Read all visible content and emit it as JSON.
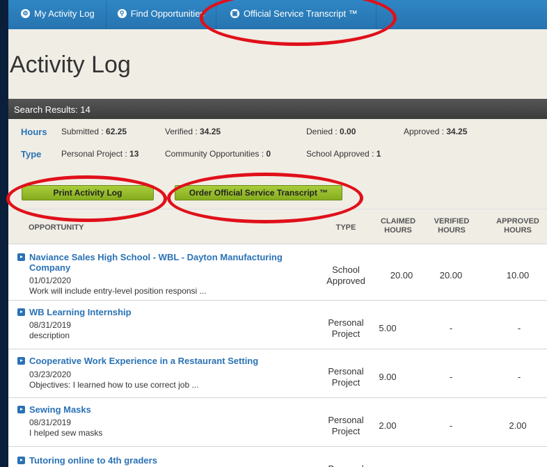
{
  "nav": {
    "items": [
      {
        "icon": "gear-icon",
        "label": "My Activity Log"
      },
      {
        "icon": "search-icon",
        "label": "Find Opportunities"
      },
      {
        "icon": "transcript-icon",
        "label": "Official Service Transcript ™"
      }
    ]
  },
  "page": {
    "title": "Activity Log"
  },
  "results": {
    "label": "Search Results: 14"
  },
  "hours": {
    "heading": "Hours",
    "submitted": "Submitted : ",
    "submitted_value": "62.25",
    "verified": "Verified : ",
    "verified_value": "34.25",
    "denied": "Denied : ",
    "denied_value": "0.00",
    "approved": "Approved : ",
    "approved_value": "34.25"
  },
  "type": {
    "heading": "Type",
    "personal": "Personal Project : ",
    "personal_value": "13",
    "community": "Community Opportunities : ",
    "community_value": "0",
    "school": "School Approved : ",
    "school_value": "1"
  },
  "buttons": {
    "print": "Print Activity Log",
    "order": "Order Official Service Transcript ™"
  },
  "table": {
    "headers": {
      "opportunity": "OPPORTUNITY",
      "type": "TYPE",
      "claimed": "CLAIMED HOURS",
      "verified": "VERIFIED HOURS",
      "approved": "APPROVED HOURS"
    },
    "rows": [
      {
        "name": "Naviance Sales High School  -  WBL - Dayton Manufacturing Company",
        "date": "01/01/2020",
        "desc": "Work will include entry-level position responsi ...",
        "type": "School Approved",
        "claimed": "20.00",
        "verified": "20.00",
        "approved": "10.00"
      },
      {
        "name": "WB Learning Internship",
        "date": "08/31/2019",
        "desc": "description",
        "type": "Personal Project",
        "claimed": "5.00",
        "verified": "-",
        "approved": "-"
      },
      {
        "name": "Cooperative Work Experience in a Restaurant Setting",
        "date": "03/23/2020",
        "desc": "Objectives: I learned how to use correct job ...",
        "type": "Personal Project",
        "claimed": "9.00",
        "verified": "-",
        "approved": "-"
      },
      {
        "name": "Sewing Masks",
        "date": "08/31/2019",
        "desc": "I helped sew masks",
        "type": "Personal Project",
        "claimed": "2.00",
        "verified": "-",
        "approved": "2.00"
      },
      {
        "name": "Tutoring online to 4th graders",
        "date": "",
        "desc": "",
        "type": "Personal",
        "claimed": "",
        "verified": "",
        "approved": ""
      }
    ]
  },
  "colors": {
    "nav": "#2674b0",
    "link": "#2a72b5",
    "button": "#9bc12e",
    "annotation": "#e0101a"
  }
}
